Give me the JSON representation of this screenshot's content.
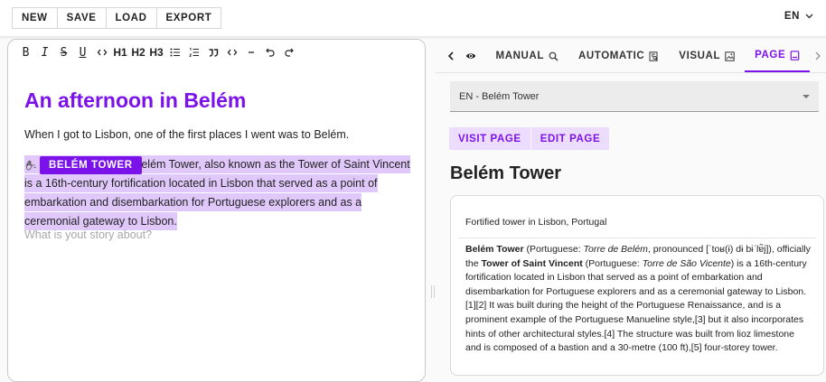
{
  "topbar": {
    "buttons": [
      "NEW",
      "SAVE",
      "LOAD",
      "EXPORT"
    ],
    "language": "EN"
  },
  "editor": {
    "toolbar": [
      "B",
      "I",
      "S",
      "U",
      "code",
      "H1",
      "H2",
      "H3",
      "bullet-list",
      "numbered-list",
      "quote",
      "code-block",
      "horizontal-rule",
      "undo",
      "redo"
    ],
    "toolbar_labels": {
      "h1": "H1",
      "h2": "H2",
      "h3": "H3"
    },
    "title": "An afternoon in Belém",
    "paragraph": "When I got to Lisbon, one of the first places I went was to Belém.",
    "entity_chip": "BELÉM TOWER",
    "highlight_lead": "Belém Tower, also known as the Tower of Saint Vincent",
    "highlight_rest": "is a 16th-century fortification located in Lisbon that served as a point of embarkation and disembarkation for Portuguese explorers and as a ceremonial gateway to Lisbon.",
    "placeholder": "What is yout story about?"
  },
  "panel": {
    "tabs": [
      {
        "label": "MANUAL",
        "icon": "search-icon"
      },
      {
        "label": "AUTOMATIC",
        "icon": "document-search-icon"
      },
      {
        "label": "VISUAL",
        "icon": "image-icon"
      },
      {
        "label": "PAGE",
        "icon": "page-icon",
        "active": true
      }
    ],
    "select_value": "EN - Belém Tower",
    "actions": [
      "VISIT PAGE",
      "EDIT PAGE"
    ],
    "page_title": "Belém Tower",
    "card_subtitle": "Fortified tower in Lisbon, Portugal",
    "card": {
      "b1": "Belém Tower",
      "t1": " (Portuguese: ",
      "i1": "Torre de Belém",
      "t2": ", pronounced [ˈtoʁ(ɨ) dɨ bɨˈlɐ̃j]), officially the ",
      "b2": "Tower of Saint Vincent",
      "t3": " (Portuguese: ",
      "i2": "Torre de São Vicente",
      "t4": ") is a 16th-century fortification located in Lisbon that served as a point of embarkation and disembarkation for Portuguese explorers and as a ceremonial gateway to Lisbon.[1][2] It was built during the height of the Portuguese Renaissance, and is a prominent example of the Portuguese Manueline style,[3] but it also incorporates hints of other architectural styles.[4] The structure was built from lioz limestone and is composed of a bastion and a 30-metre (100 ft),[5] four-storey tower."
    }
  },
  "colors": {
    "accent": "#7c12ea",
    "highlight": "#e1c8fb",
    "action_bg": "#ecdcfd"
  }
}
